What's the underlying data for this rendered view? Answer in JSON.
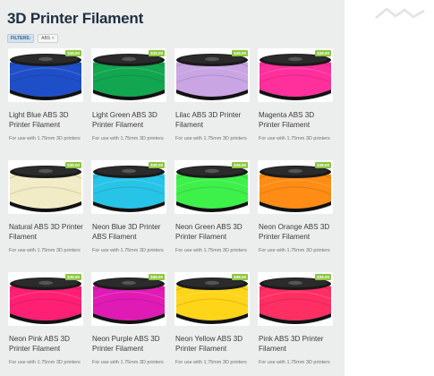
{
  "page_title": "3D Printer Filament",
  "filters": {
    "label": "FILTERS:",
    "chips": [
      {
        "label": "ABS"
      }
    ]
  },
  "products": [
    {
      "name": "Light Blue ABS 3D Printer Filament",
      "desc": "For use with 1.75mm 3D printers",
      "price": "$38.00",
      "color": "#1f4fc8"
    },
    {
      "name": "Light Green ABS 3D Printer Filament",
      "desc": "For use with 1.75mm 3D printers",
      "price": "$38.00",
      "color": "#12a650"
    },
    {
      "name": "Lilac ABS 3D Printer Filament",
      "desc": "For use with 1.75mm 3D printers",
      "price": "$38.00",
      "color": "#c9a5e4"
    },
    {
      "name": "Magenta ABS 3D Printer Filament",
      "desc": "For use with 1.75mm 3D printers",
      "price": "$38.00",
      "color": "#ff2f9c"
    },
    {
      "name": "Natural ABS 3D Printer Filament",
      "desc": "For use with 1.75mm 3D printers",
      "price": "$38.00",
      "color": "#f1ecc6"
    },
    {
      "name": "Neon Blue 3D Printer ABS Filament",
      "desc": "For use with 1.75mm 3D printers",
      "price": "$38.00",
      "color": "#27c4e8"
    },
    {
      "name": "Neon Green ABS 3D Printer Filament",
      "desc": "For use with 1.75mm 3D printers",
      "price": "$38.00",
      "color": "#3ef04a"
    },
    {
      "name": "Neon Orange ABS 3D Printer Filament",
      "desc": "For use with 1.75mm 3D printers",
      "price": "$38.00",
      "color": "#ff8c15"
    },
    {
      "name": "Neon Pink ABS 3D Printer Filament",
      "desc": "For use with 1.75mm 3D printers",
      "price": "$38.00",
      "color": "#ff1f73"
    },
    {
      "name": "Neon Purple ABS 3D Printer Filament",
      "desc": "For use with 1.75mm 3D printers",
      "price": "$38.00",
      "color": "#e01bb5"
    },
    {
      "name": "Neon Yellow ABS 3D Printer Filament",
      "desc": "For use with 1.75mm 3D printers",
      "price": "$38.00",
      "color": "#ffd51a"
    },
    {
      "name": "Pink ABS 3D Printer Filament",
      "desc": "For use with 1.75mm 3D printers",
      "price": "$38.00",
      "color": "#ff2e63"
    }
  ]
}
